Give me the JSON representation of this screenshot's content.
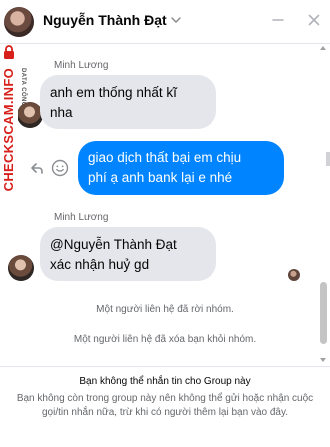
{
  "header": {
    "contact_name": "Nguyễn Thành Đạt",
    "icons": {
      "chevron": "chevron-down-icon",
      "minimize": "minimize-icon",
      "close": "close-icon"
    }
  },
  "watermark": {
    "main": "CHECKSCAM.INFO",
    "sub": "DATA CÔNG KHAI"
  },
  "messages": [
    {
      "sender": "Minh Lương",
      "direction": "incoming",
      "lines": [
        "anh em thống nhất kĩ",
        "nha"
      ]
    },
    {
      "sender": "",
      "direction": "outgoing",
      "lines": [
        "giao dịch thất bại em chịu",
        "phí ạ anh bank lại e nhé"
      ]
    },
    {
      "sender": "Minh Lương",
      "direction": "incoming",
      "lines": [
        "@Nguyễn Thành Đạt",
        "xác nhận huỷ gd"
      ]
    }
  ],
  "system_notices": [
    "Một người liên hệ đã rời nhóm.",
    "Một người liên hệ đã xóa bạn khỏi nhóm."
  ],
  "footer": {
    "title": "Bạn không thể nhắn tin cho Group này",
    "description": "Bạn không còn trong group này nên không thể gửi hoặc nhận cuộc gọi/tin nhắn nữa, trừ khi có người thêm lại bạn vào đây."
  },
  "colors": {
    "outgoing_bubble": "#0084ff",
    "incoming_bubble": "#e4e6eb",
    "watermark": "#d8201b",
    "secondary_text": "#65676b"
  }
}
